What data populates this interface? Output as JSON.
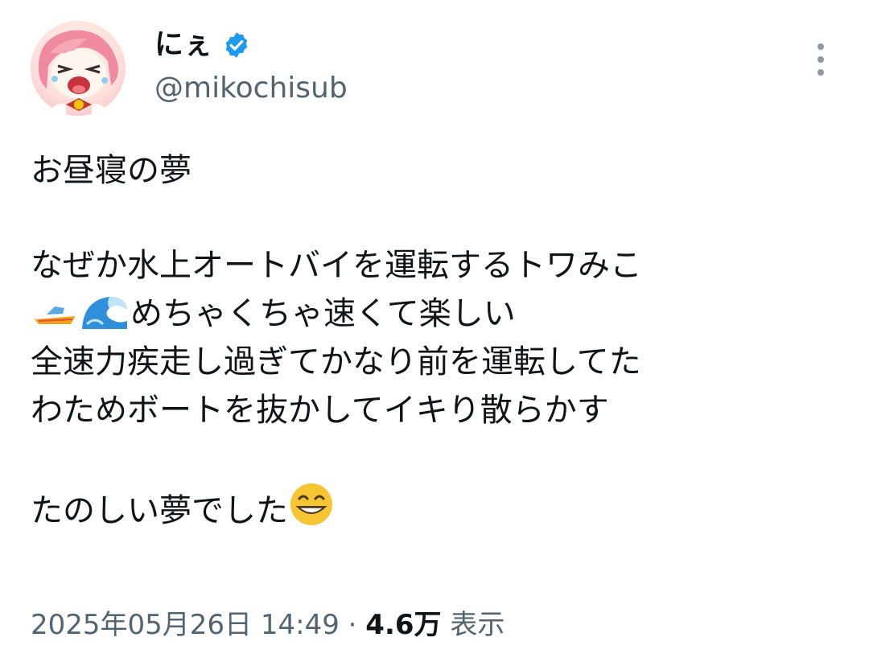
{
  "author": {
    "display_name": "にぇ",
    "handle": "@mikochisub",
    "avatar_icon": "avatar-pink-hair-character",
    "verified_icon": "verified-badge-icon",
    "verified_color": "#1d9bf0"
  },
  "menu": {
    "icon": "more-vertical-icon"
  },
  "tweet": {
    "line1": "お昼寝の夢",
    "line2": "なぜか水上オートバイを運転するトワみこ",
    "line3_emojis": [
      "speedboat-emoji",
      "wave-emoji"
    ],
    "line3_text": "めちゃくちゃ速くて楽しい",
    "line4": "全速力疾走し過ぎてかなり前を運転してた",
    "line5": "わためボートを抜かしてイキり散らかす",
    "line6_text": "たのしい夢でした",
    "line6_emoji": "grinning-face-emoji"
  },
  "meta": {
    "timestamp": "2025年05月26日 14:49",
    "separator": " · ",
    "views_count": "4.6万",
    "views_label": " 表示"
  }
}
